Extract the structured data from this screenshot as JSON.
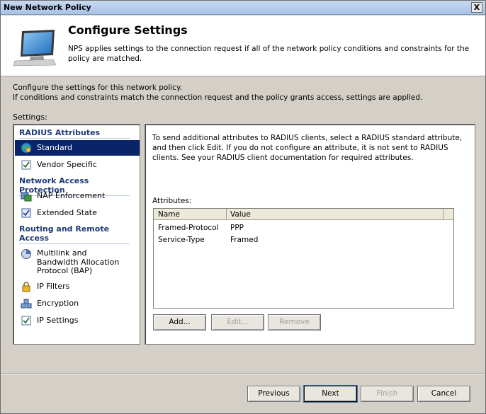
{
  "window": {
    "title": "New Network Policy",
    "close_glyph": "X"
  },
  "header": {
    "title": "Configure Settings",
    "description": "NPS applies settings to the connection request if all of the network policy conditions and constraints for the policy are matched.",
    "icon": "computer-monitor-icon"
  },
  "intro": {
    "line1": "Configure the settings for this network policy.",
    "line2": "If conditions and constraints match the connection request and the policy grants access, settings are applied."
  },
  "settings_label": "Settings:",
  "nav": {
    "groups": [
      {
        "label": "RADIUS Attributes"
      },
      {
        "label": "Network Access Protection"
      },
      {
        "label": "Routing and Remote Access"
      }
    ],
    "items": [
      {
        "label": "Standard",
        "icon": "globe-icon",
        "selected": true
      },
      {
        "label": "Vendor Specific",
        "icon": "checkbox-doc-icon"
      },
      {
        "label": "NAP Enforcement",
        "icon": "nap-enforcement-icon"
      },
      {
        "label": "Extended State",
        "icon": "checkbox-doc-icon"
      },
      {
        "label": "Multilink and Bandwidth Allocation Protocol (BAP)",
        "icon": "pie-icon"
      },
      {
        "label": "IP Filters",
        "icon": "lock-icon"
      },
      {
        "label": "Encryption",
        "icon": "encryption-icon"
      },
      {
        "label": "IP Settings",
        "icon": "checkbox-doc-icon"
      }
    ]
  },
  "right": {
    "description": "To send additional attributes to RADIUS clients, select a RADIUS standard attribute, and then click Edit. If you do not configure an attribute, it is not sent to RADIUS clients. See your RADIUS client documentation for required attributes.",
    "attributes_label": "Attributes:",
    "columns": [
      "Name",
      "Value"
    ],
    "rows": [
      {
        "name": "Framed-Protocol",
        "value": "PPP"
      },
      {
        "name": "Service-Type",
        "value": "Framed"
      }
    ],
    "buttons": {
      "add": "Add...",
      "edit": "Edit...",
      "remove": "Remove"
    }
  },
  "footer": {
    "previous": "Previous",
    "next": "Next",
    "finish": "Finish",
    "cancel": "Cancel"
  },
  "colors": {
    "selection": "#0a246a",
    "group_header": "#1f3a78",
    "disabled_text": "#a0a0a0"
  }
}
